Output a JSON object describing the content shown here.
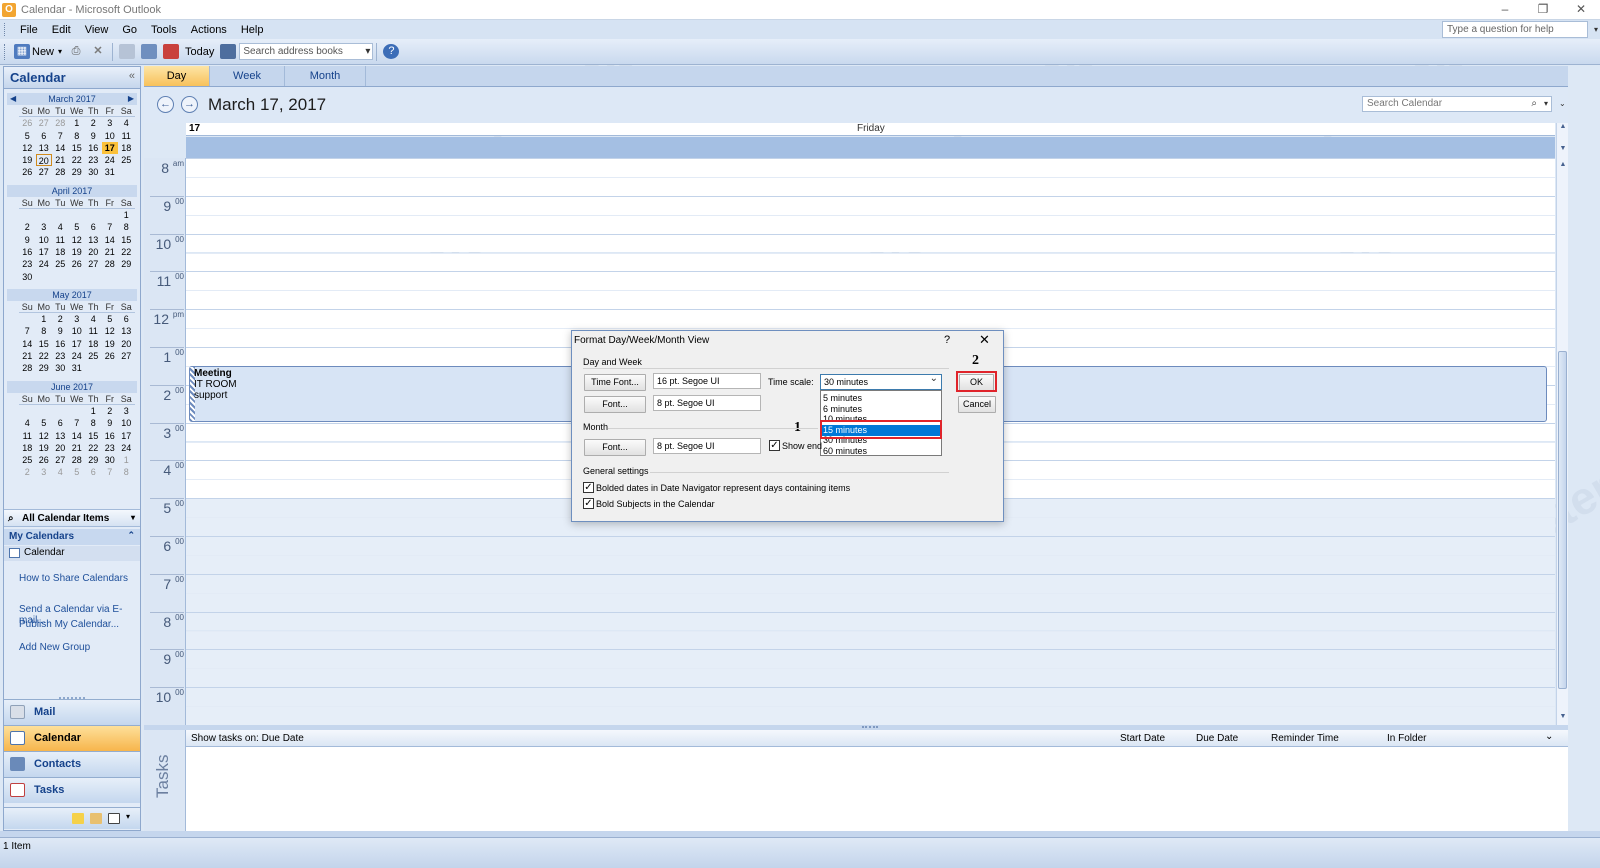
{
  "window": {
    "title": "Calendar - Microsoft Outlook",
    "app_icon": "O",
    "controls": [
      "–",
      "❐",
      "✕"
    ]
  },
  "menu": [
    "File",
    "Edit",
    "View",
    "Go",
    "Tools",
    "Actions",
    "Help"
  ],
  "help_box": "Type a question for help",
  "toolbar": {
    "new_label": "New",
    "today_label": "Today",
    "address_search_placeholder": "Search address books"
  },
  "nav": {
    "title": "Calendar",
    "collapse": "«",
    "mini_calendars": [
      {
        "month": "March 2017",
        "days_header": [
          "Su",
          "Mo",
          "Tu",
          "We",
          "Th",
          "Fr",
          "Sa"
        ],
        "weeks": [
          [
            "26",
            "27",
            "28",
            "1",
            "2",
            "3",
            "4"
          ],
          [
            "5",
            "6",
            "7",
            "8",
            "9",
            "10",
            "11"
          ],
          [
            "12",
            "13",
            "14",
            "15",
            "16",
            "17",
            "18"
          ],
          [
            "19",
            "20",
            "21",
            "22",
            "23",
            "24",
            "25"
          ],
          [
            "26",
            "27",
            "28",
            "29",
            "30",
            "31",
            ""
          ]
        ]
      },
      {
        "month": "April 2017",
        "days_header": [
          "Su",
          "Mo",
          "Tu",
          "We",
          "Th",
          "Fr",
          "Sa"
        ],
        "weeks": [
          [
            "",
            "",
            "",
            "",
            "",
            "",
            "1"
          ],
          [
            "2",
            "3",
            "4",
            "5",
            "6",
            "7",
            "8"
          ],
          [
            "9",
            "10",
            "11",
            "12",
            "13",
            "14",
            "15"
          ],
          [
            "16",
            "17",
            "18",
            "19",
            "20",
            "21",
            "22"
          ],
          [
            "23",
            "24",
            "25",
            "26",
            "27",
            "28",
            "29"
          ],
          [
            "30",
            "",
            "",
            "",
            "",
            "",
            ""
          ]
        ]
      },
      {
        "month": "May 2017",
        "days_header": [
          "Su",
          "Mo",
          "Tu",
          "We",
          "Th",
          "Fr",
          "Sa"
        ],
        "weeks": [
          [
            "",
            "1",
            "2",
            "3",
            "4",
            "5",
            "6"
          ],
          [
            "7",
            "8",
            "9",
            "10",
            "11",
            "12",
            "13"
          ],
          [
            "14",
            "15",
            "16",
            "17",
            "18",
            "19",
            "20"
          ],
          [
            "21",
            "22",
            "23",
            "24",
            "25",
            "26",
            "27"
          ],
          [
            "28",
            "29",
            "30",
            "31",
            "",
            "",
            ""
          ]
        ]
      },
      {
        "month": "June 2017",
        "days_header": [
          "Su",
          "Mo",
          "Tu",
          "We",
          "Th",
          "Fr",
          "Sa"
        ],
        "weeks": [
          [
            "",
            "",
            "",
            "",
            "1",
            "2",
            "3"
          ],
          [
            "4",
            "5",
            "6",
            "7",
            "8",
            "9",
            "10"
          ],
          [
            "11",
            "12",
            "13",
            "14",
            "15",
            "16",
            "17"
          ],
          [
            "18",
            "19",
            "20",
            "21",
            "22",
            "23",
            "24"
          ],
          [
            "25",
            "26",
            "27",
            "28",
            "29",
            "30",
            "1"
          ],
          [
            "2",
            "3",
            "4",
            "5",
            "6",
            "7",
            "8"
          ]
        ]
      }
    ],
    "all_calendar_items": "All Calendar Items",
    "my_calendars": "My Calendars",
    "calendar_item": "Calendar",
    "links": [
      "How to Share Calendars",
      "Send a Calendar via E-mail...",
      "Publish My Calendar...",
      "Add New Group"
    ],
    "buttons": [
      "Mail",
      "Calendar",
      "Contacts",
      "Tasks"
    ]
  },
  "view_tabs": [
    "Day",
    "Week",
    "Month"
  ],
  "date_title": "March 17, 2017",
  "search_calendar_placeholder": "Search Calendar",
  "day_header": {
    "number": "17",
    "name": "Friday"
  },
  "times": [
    {
      "h": "8",
      "m": "am"
    },
    {
      "h": "9",
      "m": "00"
    },
    {
      "h": "10",
      "m": "00"
    },
    {
      "h": "11",
      "m": "00"
    },
    {
      "h": "12",
      "m": "pm"
    },
    {
      "h": "1",
      "m": "00"
    },
    {
      "h": "2",
      "m": "00"
    },
    {
      "h": "3",
      "m": "00"
    },
    {
      "h": "4",
      "m": "00"
    },
    {
      "h": "5",
      "m": "00"
    },
    {
      "h": "6",
      "m": "00"
    },
    {
      "h": "7",
      "m": "00"
    },
    {
      "h": "8",
      "m": "00"
    },
    {
      "h": "9",
      "m": "00"
    },
    {
      "h": "10",
      "m": "00"
    }
  ],
  "appointment": {
    "subject": "Meeting",
    "location": "IT ROOM",
    "body": "support"
  },
  "tasks": {
    "label": "Tasks",
    "show_on": "Show tasks on: Due Date",
    "columns": [
      "Start Date",
      "Due Date",
      "Reminder Time",
      "In Folder"
    ]
  },
  "status": "1 Item",
  "dialog": {
    "title": "Format Day/Week/Month View",
    "help": "?",
    "close": "✕",
    "day_week_group": "Day and Week",
    "time_font_btn": "Time Font...",
    "time_font_value": "16 pt. Segoe UI",
    "font_btn": "Font...",
    "font_value": "8 pt. Segoe UI",
    "time_scale_label": "Time scale:",
    "time_scale_value": "30 minutes",
    "time_scale_options": [
      "5 minutes",
      "6 minutes",
      "10 minutes",
      "15 minutes",
      "30 minutes",
      "60 minutes"
    ],
    "time_scale_highlighted": "15 minutes",
    "month_group": "Month",
    "month_font_btn": "Font...",
    "month_font_value": "8 pt. Segoe UI",
    "show_end_label": "Show end",
    "general_group": "General settings",
    "bolded_dates_label": "Bolded dates in Date Navigator represent days containing items",
    "bold_subjects_label": "Bold Subjects in the Calendar",
    "ok_btn": "OK",
    "cancel_btn": "Cancel",
    "step1": "1",
    "step2": "2"
  },
  "watermark": "mail master",
  "colors": {
    "accent": "#f8c15b",
    "highlight": "#0078d7",
    "annotation": "#e0242b"
  }
}
